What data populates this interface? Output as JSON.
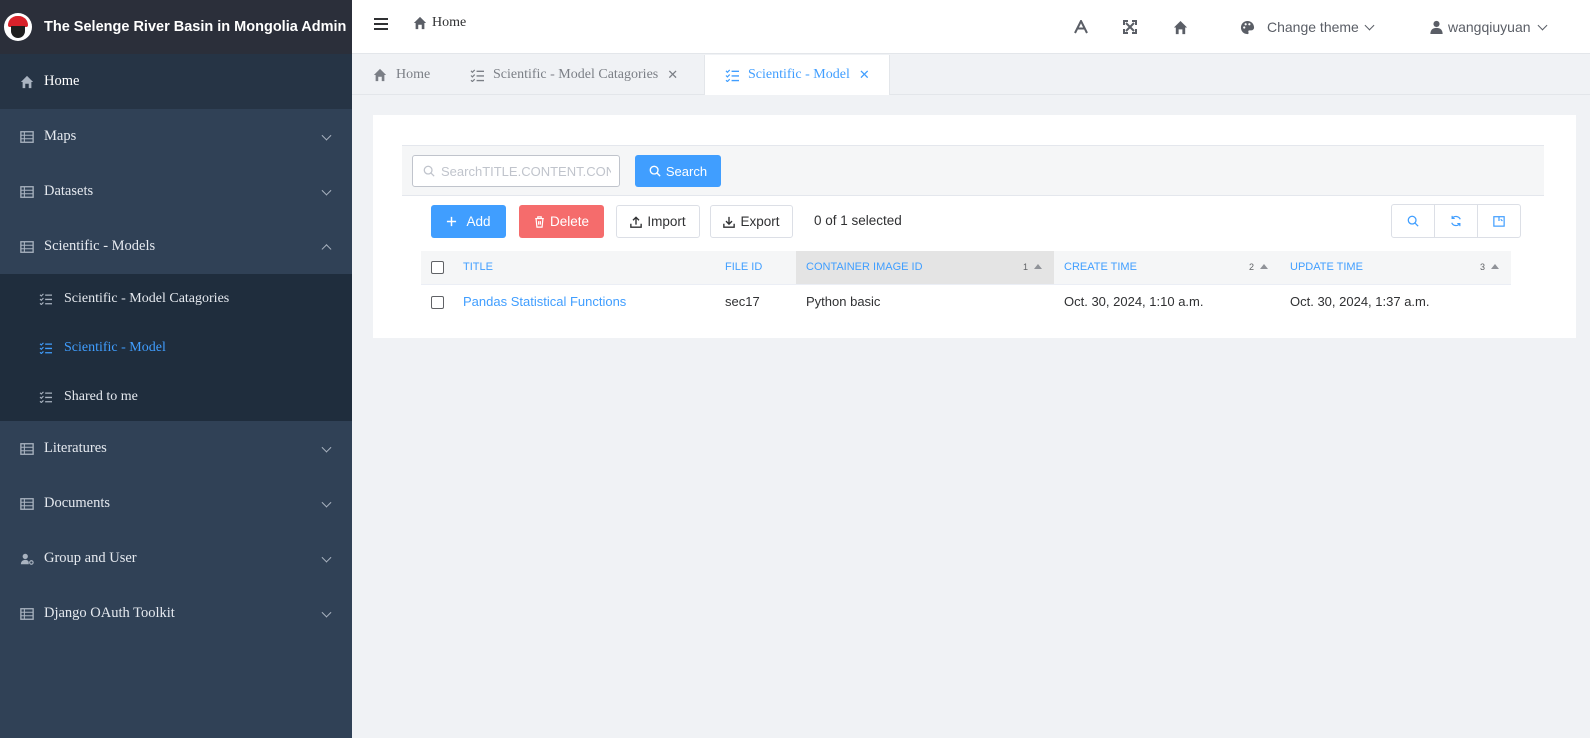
{
  "app": {
    "title": "The Selenge River Basin in Mongolia Admin"
  },
  "sidebar": {
    "items": [
      {
        "label": "Home"
      },
      {
        "label": "Maps"
      },
      {
        "label": "Datasets"
      },
      {
        "label": "Scientific - Models",
        "children": [
          {
            "label": "Scientific - Model Catagories"
          },
          {
            "label": "Scientific - Model"
          },
          {
            "label": "Shared to me"
          }
        ]
      },
      {
        "label": "Literatures"
      },
      {
        "label": "Documents"
      },
      {
        "label": "Group and User"
      },
      {
        "label": "Django OAuth Toolkit"
      }
    ]
  },
  "navbar": {
    "breadcrumb": "Home",
    "theme_label": "Change theme",
    "user_label": "wangqiuyuan"
  },
  "tabs": [
    {
      "label": "Home"
    },
    {
      "label": "Scientific - Model Catagories"
    },
    {
      "label": "Scientific - Model"
    }
  ],
  "search": {
    "placeholder": "SearchTITLE.CONTENT.CONTAINER IMAGE ID",
    "button_label": "Search"
  },
  "toolbar": {
    "add_label": "Add",
    "delete_label": "Delete",
    "import_label": "Import",
    "export_label": "Export",
    "selection_text": "0 of 1 selected"
  },
  "table": {
    "columns": [
      {
        "label": "TITLE"
      },
      {
        "label": "FILE ID"
      },
      {
        "label": "CONTAINER IMAGE ID",
        "sort_order": "1"
      },
      {
        "label": "CREATE TIME",
        "sort_order": "2"
      },
      {
        "label": "UPDATE TIME",
        "sort_order": "3"
      }
    ],
    "rows": [
      {
        "title": "Pandas Statistical Functions",
        "file_id": "sec17",
        "container_image_id": "Python basic",
        "create_time": "Oct. 30, 2024, 1:10 a.m.",
        "update_time": "Oct. 30, 2024, 1:37 a.m."
      }
    ]
  },
  "colors": {
    "sidebar_bg": "#304156",
    "accent": "#409eff",
    "danger": "#f56c6c"
  }
}
